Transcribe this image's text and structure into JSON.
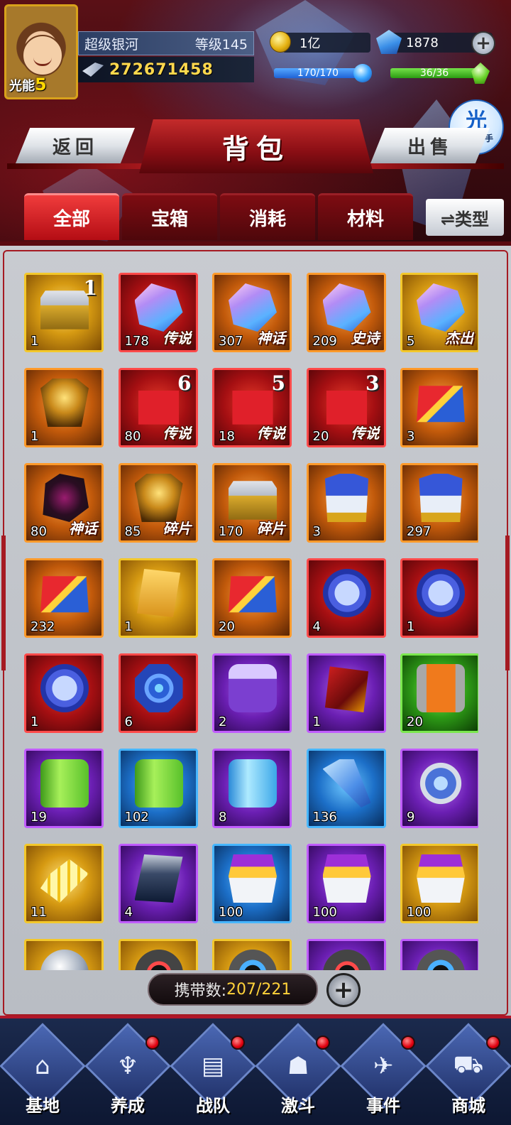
{
  "player": {
    "badge_label": "光能",
    "badge_level": "5",
    "name": "超级银河",
    "level": "等级145",
    "power": "272671458"
  },
  "resources": {
    "gold": "1亿",
    "gems": "1878",
    "energy_blue": "170/170",
    "energy_blue_fraction": 1.0,
    "energy_green": "36/36",
    "energy_green_fraction": 1.0
  },
  "helper": {
    "icon": "光",
    "label": "光环助手"
  },
  "header": {
    "title": "背包",
    "back_label": "返回",
    "sell_label": "出售"
  },
  "tabs": [
    {
      "label": "全部",
      "active": true
    },
    {
      "label": "宝箱",
      "active": false
    },
    {
      "label": "消耗",
      "active": false
    },
    {
      "label": "材料",
      "active": false
    }
  ],
  "type_button": "⇌类型",
  "items": [
    {
      "count": "1",
      "tag": "",
      "star": "1",
      "quality": "gold",
      "art": "box",
      "name": "item-chest-silver"
    },
    {
      "count": "178",
      "tag": "传说",
      "star": "",
      "quality": "red",
      "art": "crystal",
      "name": "item-crystal-legend"
    },
    {
      "count": "307",
      "tag": "神话",
      "star": "",
      "quality": "orange",
      "art": "crystal",
      "name": "item-crystal-myth"
    },
    {
      "count": "209",
      "tag": "史诗",
      "star": "",
      "quality": "orange",
      "art": "crystal",
      "name": "item-crystal-epic"
    },
    {
      "count": "5",
      "tag": "杰出",
      "star": "",
      "quality": "gold",
      "art": "crystal",
      "name": "item-crystal-outstanding"
    },
    {
      "count": "1",
      "tag": "",
      "star": "",
      "quality": "orange",
      "art": "helmet",
      "name": "item-gold-box"
    },
    {
      "count": "80",
      "tag": "传说",
      "star": "6",
      "quality": "red",
      "art": "gift",
      "name": "item-gift-6"
    },
    {
      "count": "18",
      "tag": "传说",
      "star": "5",
      "quality": "red",
      "art": "gift",
      "name": "item-gift-5"
    },
    {
      "count": "20",
      "tag": "传说",
      "star": "3",
      "quality": "red",
      "art": "gift",
      "name": "item-gift-3"
    },
    {
      "count": "3",
      "tag": "",
      "star": "",
      "quality": "orange",
      "art": "chest",
      "name": "item-chest-red"
    },
    {
      "count": "80",
      "tag": "神话",
      "star": "",
      "quality": "orange",
      "art": "dark",
      "name": "item-dark-cube"
    },
    {
      "count": "85",
      "tag": "碎片",
      "star": "",
      "quality": "orange",
      "art": "helmet",
      "name": "item-helmet-fragment"
    },
    {
      "count": "170",
      "tag": "碎片",
      "star": "",
      "quality": "orange",
      "art": "box",
      "name": "item-box-fragment"
    },
    {
      "count": "3",
      "tag": "",
      "star": "",
      "quality": "orange",
      "art": "robot",
      "name": "item-robot-head"
    },
    {
      "count": "297",
      "tag": "",
      "star": "",
      "quality": "orange",
      "art": "robot",
      "name": "item-robot-head-2"
    },
    {
      "count": "232",
      "tag": "",
      "star": "",
      "quality": "orange",
      "art": "chest",
      "name": "item-chest-red-2"
    },
    {
      "count": "1",
      "tag": "",
      "star": "",
      "quality": "gold",
      "art": "card",
      "name": "item-mystery-card"
    },
    {
      "count": "20",
      "tag": "",
      "star": "",
      "quality": "orange",
      "art": "chest",
      "name": "item-blue-chest"
    },
    {
      "count": "4",
      "tag": "",
      "star": "",
      "quality": "red",
      "art": "coin",
      "name": "item-medal"
    },
    {
      "count": "1",
      "tag": "",
      "star": "",
      "quality": "red",
      "art": "coin",
      "name": "item-medal-2"
    },
    {
      "count": "1",
      "tag": "",
      "star": "",
      "quality": "red",
      "art": "coin",
      "name": "item-medal-3"
    },
    {
      "count": "6",
      "tag": "",
      "star": "",
      "quality": "red",
      "art": "target",
      "name": "item-blue-token"
    },
    {
      "count": "2",
      "tag": "",
      "star": "",
      "quality": "purple",
      "art": "purplebox",
      "name": "item-energy-box"
    },
    {
      "count": "1",
      "tag": "",
      "star": "",
      "quality": "purple",
      "art": "redcard",
      "name": "item-red-card"
    },
    {
      "count": "20",
      "tag": "",
      "star": "",
      "quality": "green",
      "art": "canister",
      "name": "item-canister"
    },
    {
      "count": "19",
      "tag": "",
      "star": "",
      "quality": "purple",
      "art": "greenjar",
      "name": "item-green-jar"
    },
    {
      "count": "102",
      "tag": "",
      "star": "",
      "quality": "blue",
      "art": "greenjar",
      "name": "item-green-jar-small"
    },
    {
      "count": "8",
      "tag": "",
      "star": "",
      "quality": "purple",
      "art": "bluejar",
      "name": "item-blue-jar"
    },
    {
      "count": "136",
      "tag": "",
      "star": "",
      "quality": "blue",
      "art": "bottle",
      "name": "item-blue-bottle"
    },
    {
      "count": "9",
      "tag": "",
      "star": "",
      "quality": "purple",
      "art": "ring",
      "name": "item-ring"
    },
    {
      "count": "11",
      "tag": "",
      "star": "",
      "quality": "gold",
      "art": "pixels",
      "name": "item-pixel-shard"
    },
    {
      "count": "4",
      "tag": "",
      "star": "",
      "quality": "purple",
      "art": "tablet",
      "name": "item-tablet"
    },
    {
      "count": "100",
      "tag": "",
      "star": "",
      "quality": "blue",
      "art": "basket",
      "name": "item-basket-blue"
    },
    {
      "count": "100",
      "tag": "",
      "star": "",
      "quality": "purple",
      "art": "basket",
      "name": "item-basket-purple"
    },
    {
      "count": "100",
      "tag": "",
      "star": "",
      "quality": "gold",
      "art": "basket",
      "name": "item-basket-gold"
    },
    {
      "count": "",
      "tag": "",
      "star": "",
      "quality": "gold",
      "art": "sphere",
      "name": "item-sphere"
    },
    {
      "count": "",
      "tag": "",
      "star": "",
      "quality": "gold",
      "art": "disc",
      "name": "item-disc-red"
    },
    {
      "count": "",
      "tag": "",
      "star": "",
      "quality": "gold",
      "art": "discblue",
      "name": "item-disc-blue"
    },
    {
      "count": "",
      "tag": "",
      "star": "",
      "quality": "purple",
      "art": "disc",
      "name": "item-disc-purple"
    },
    {
      "count": "",
      "tag": "",
      "star": "",
      "quality": "purple",
      "art": "discblue",
      "name": "item-disc-purple-2"
    }
  ],
  "capacity": {
    "label": "携带数:",
    "value": "207/221"
  },
  "nav": [
    {
      "label": "基地",
      "icon": "base-icon",
      "glyph": "⌂",
      "dot": false
    },
    {
      "label": "养成",
      "icon": "trophy-icon",
      "glyph": "♆",
      "dot": true
    },
    {
      "label": "战队",
      "icon": "cards-icon",
      "glyph": "▤",
      "dot": true
    },
    {
      "label": "激斗",
      "icon": "fighter-icon",
      "glyph": "☗",
      "dot": true
    },
    {
      "label": "事件",
      "icon": "jet-icon",
      "glyph": "✈",
      "dot": true
    },
    {
      "label": "商城",
      "icon": "cart-icon",
      "glyph": "⛟",
      "dot": true
    }
  ]
}
